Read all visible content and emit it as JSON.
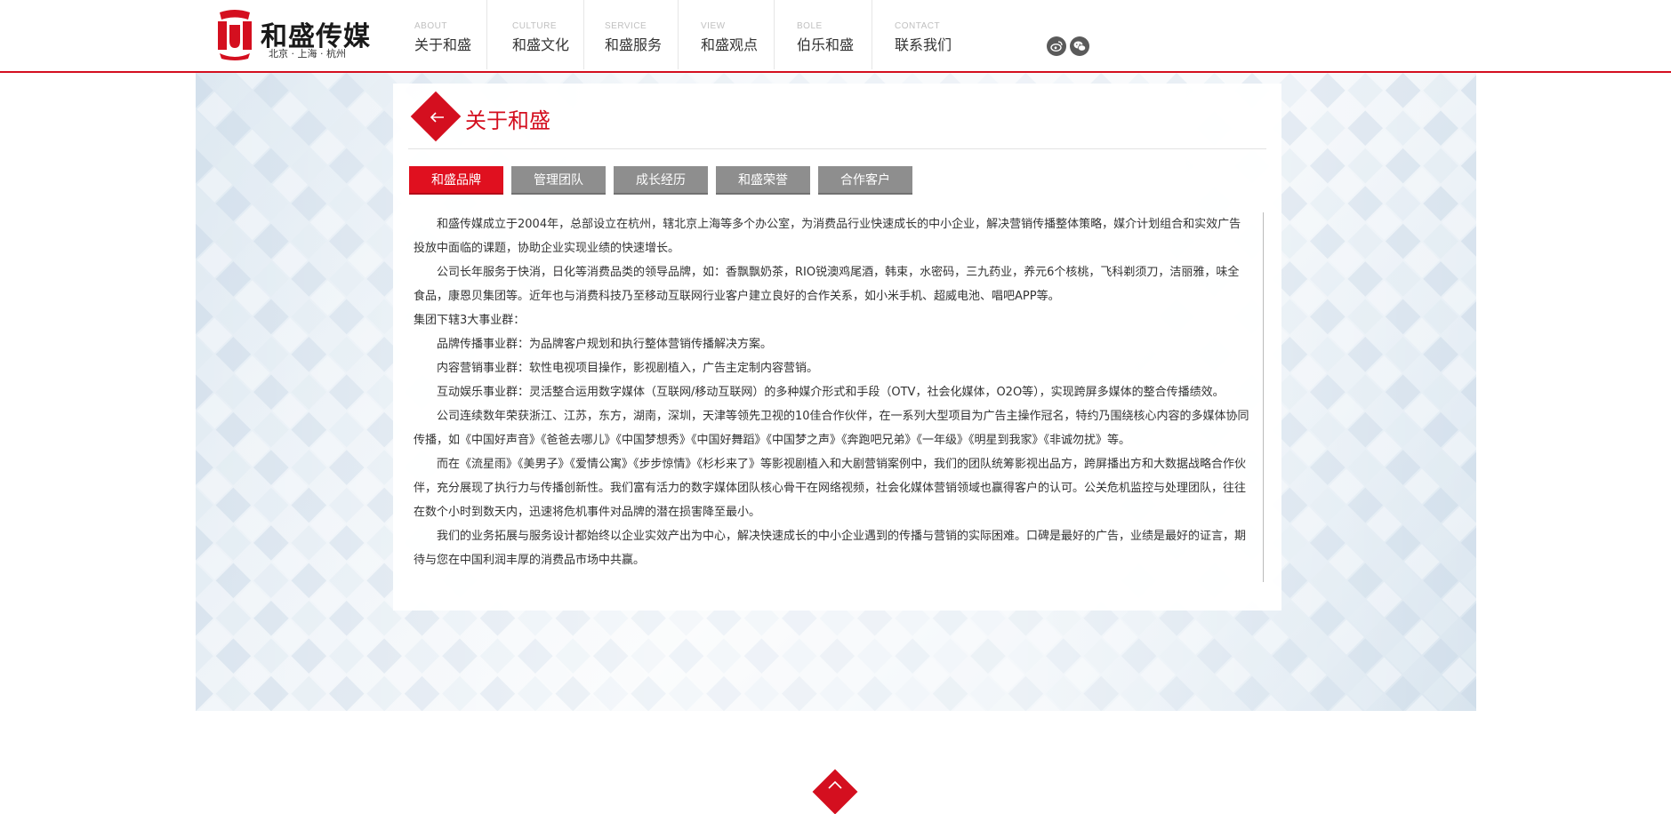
{
  "brand": {
    "name": "和盛传媒",
    "cities": "北京 · 上海 · 杭州",
    "color": "#d40f1f"
  },
  "nav": {
    "items": [
      {
        "en": "ABOUT",
        "cn": "关于和盛"
      },
      {
        "en": "CULTURE",
        "cn": "和盛文化"
      },
      {
        "en": "SERVICE",
        "cn": "和盛服务"
      },
      {
        "en": "VIEW",
        "cn": "和盛观点"
      },
      {
        "en": "BOLE",
        "cn": "伯乐和盛"
      },
      {
        "en": "CONTACT",
        "cn": "联系我们"
      }
    ],
    "social": [
      "weibo-icon",
      "wechat-icon"
    ]
  },
  "page": {
    "title": "关于和盛"
  },
  "tabs": [
    {
      "label": "和盛品牌",
      "active": true
    },
    {
      "label": "管理团队",
      "active": false
    },
    {
      "label": "成长经历",
      "active": false
    },
    {
      "label": "和盛荣誉",
      "active": false
    },
    {
      "label": "合作客户",
      "active": false
    }
  ],
  "content": {
    "paragraphs": [
      "和盛传媒成立于2004年，总部设立在杭州，辖北京上海等多个办公室，为消费品行业快速成长的中小企业，解决营销传播整体策略，媒介计划组合和实效广告投放中面临的课题，协助企业实现业绩的快速增长。",
      "公司长年服务于快消，日化等消费品类的领导品牌，如：香飘飘奶茶，RIO锐澳鸡尾酒，韩束，水密码，三九药业，养元6个核桃，飞科剃须刀，洁丽雅，味全食品，康恩贝集团等。近年也与消费科技乃至移动互联网行业客户建立良好的合作关系，如小米手机、超威电池、唱吧APP等。",
      "集团下辖3大事业群：",
      "品牌传播事业群：为品牌客户规划和执行整体营销传播解决方案。",
      "内容营销事业群：软性电视项目操作，影视剧植入，广告主定制内容营销。",
      "互动娱乐事业群：灵活整合运用数字媒体（互联网/移动互联网）的多种媒介形式和手段（OTV，社会化媒体，O2O等），实现跨屏多媒体的整合传播绩效。",
      "公司连续数年荣获浙江、江苏，东方，湖南，深圳，天津等领先卫视的10佳合作伙伴，在一系列大型项目为广告主操作冠名，特约乃围绕核心内容的多媒体协同传播，如《中国好声音》《爸爸去哪儿》《中国梦想秀》《中国好舞蹈》《中国梦之声》《奔跑吧兄弟》《一年级》《明星到我家》《非诚勿扰》等。",
      "而在《流星雨》《美男子》《爱情公寓》《步步惊情》《杉杉来了》等影视剧植入和大剧营销案例中，我们的团队统筹影视出品方，跨屏播出方和大数据战略合作伙伴，充分展现了执行力与传播创新性。我们富有活力的数字媒体团队核心骨干在网络视频，社会化媒体营销领域也赢得客户的认可。公关危机监控与处理团队，往往在数个小时到数天内，迅速将危机事件对品牌的潜在损害降至最小。",
      "我们的业务拓展与服务设计都始终以企业实效产出为中心，解决快速成长的中小企业遇到的传播与营销的实际困难。口碑是最好的广告，业绩是最好的证言，期待与您在中国利润丰厚的消费品市场中共赢。"
    ]
  }
}
